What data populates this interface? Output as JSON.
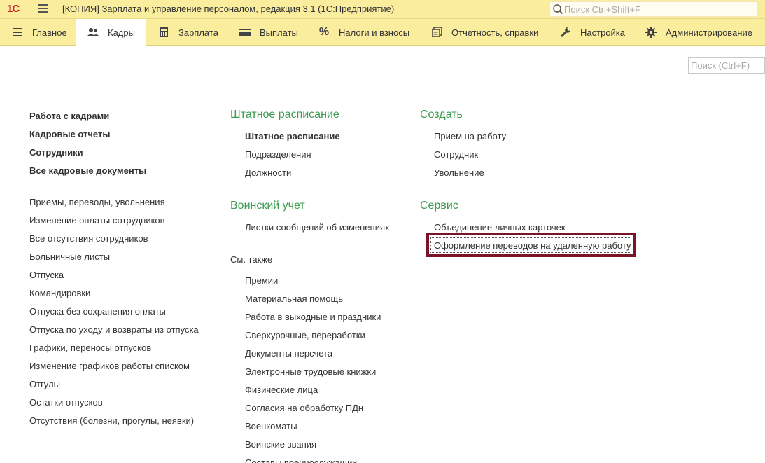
{
  "titlebar": {
    "logo": "1С",
    "title": "[КОПИЯ] Зарплата и управление персоналом, редакция 3.1  (1С:Предприятие)",
    "search_placeholder": "Поиск Ctrl+Shift+F"
  },
  "sections": [
    {
      "label": "Главное",
      "icon": "hamburger-icon"
    },
    {
      "label": "Кадры",
      "icon": "people-icon",
      "active": true
    },
    {
      "label": "Зарплата",
      "icon": "calculator-icon"
    },
    {
      "label": "Выплаты",
      "icon": "wallet-icon"
    },
    {
      "label": "Налоги и взносы",
      "icon": "percent-icon"
    },
    {
      "label": "Отчетность, справки",
      "icon": "documents-icon"
    },
    {
      "label": "Настройка",
      "icon": "wrench-icon"
    },
    {
      "label": "Администрирование",
      "icon": "gear-icon"
    }
  ],
  "local_search_placeholder": "Поиск (Ctrl+F)",
  "col1": {
    "bold_items": [
      "Работа с кадрами",
      "Кадровые отчеты",
      "Сотрудники",
      "Все кадровые документы"
    ],
    "items": [
      "Приемы, переводы, увольнения",
      "Изменение оплаты сотрудников",
      "Все отсутствия сотрудников",
      "Больничные листы",
      "Отпуска",
      "Командировки",
      "Отпуска без сохранения оплаты",
      "Отпуска по уходу и возвраты из отпуска",
      "Графики, переносы отпусков",
      "Изменение графиков работы списком",
      "Отгулы",
      "Остатки отпусков",
      "Отсутствия (болезни, прогулы, неявки)"
    ]
  },
  "col2": {
    "staffing_title": "Штатное расписание",
    "staffing_items": [
      "Штатное расписание",
      "Подразделения",
      "Должности"
    ],
    "military_title": "Воинский учет",
    "military_items": [
      "Листки сообщений об изменениях"
    ],
    "see_also_title": "См. также",
    "see_also_items": [
      "Премии",
      "Материальная помощь",
      "Работа в выходные и праздники",
      "Сверхурочные, переработки",
      "Документы персчета",
      "Электронные трудовые книжки",
      "Физические лица",
      "Согласия на обработку ПДн",
      "Военкоматы",
      "Воинские звания",
      "Составы военнослужащих"
    ]
  },
  "col3": {
    "create_title": "Создать",
    "create_items": [
      "Прием на работу",
      "Сотрудник",
      "Увольнение"
    ],
    "service_title": "Сервис",
    "service_items": [
      "Объединение личных карточек",
      "Оформление переводов на удаленную работу"
    ]
  },
  "colors": {
    "panel_bg": "#fbed9e",
    "group_title": "#3a9a4f",
    "highlight_border": "#7a1527"
  }
}
